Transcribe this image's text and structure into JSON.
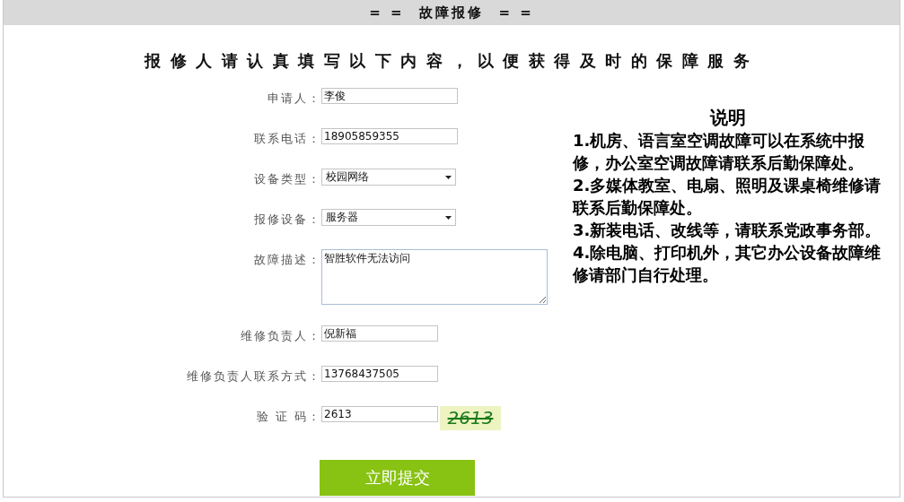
{
  "header": {
    "title": "= =  故障报修  = ="
  },
  "heading": "报修人请认真填写以下内容，以便获得及时的保障服务",
  "fields": [
    {
      "kind": "text",
      "label": "申请人：",
      "value": "李俊"
    },
    {
      "kind": "text",
      "label": "联系电话：",
      "value": "18905859355"
    },
    {
      "kind": "select",
      "label": "设备类型：",
      "value": "校园网络"
    },
    {
      "kind": "select",
      "label": "报修设备：",
      "value": "服务器"
    },
    {
      "kind": "textarea",
      "label": "故障描述：",
      "value": "智胜软件无法访问"
    },
    {
      "kind": "short",
      "label": "维修负责人：",
      "value": "倪新福"
    },
    {
      "kind": "short",
      "label": "维修负责人联系方式：",
      "value": "13768437505"
    },
    {
      "kind": "captcha",
      "label": "验 证 码：",
      "value": "2613",
      "captcha": "2613"
    }
  ],
  "submit": "立即提交",
  "notes": {
    "title": "说明",
    "items": [
      "1.机房、语言室空调故障可以在系统中报修，办公室空调故障请联系后勤保障处。",
      "2.多媒体教室、电扇、照明及课桌椅维修请联系后勤保障处。",
      "3.新装电话、改线等，请联系党政事务部。",
      "4.除电脑、打印机外，其它办公设备故障维修请部门自行处理。"
    ]
  }
}
